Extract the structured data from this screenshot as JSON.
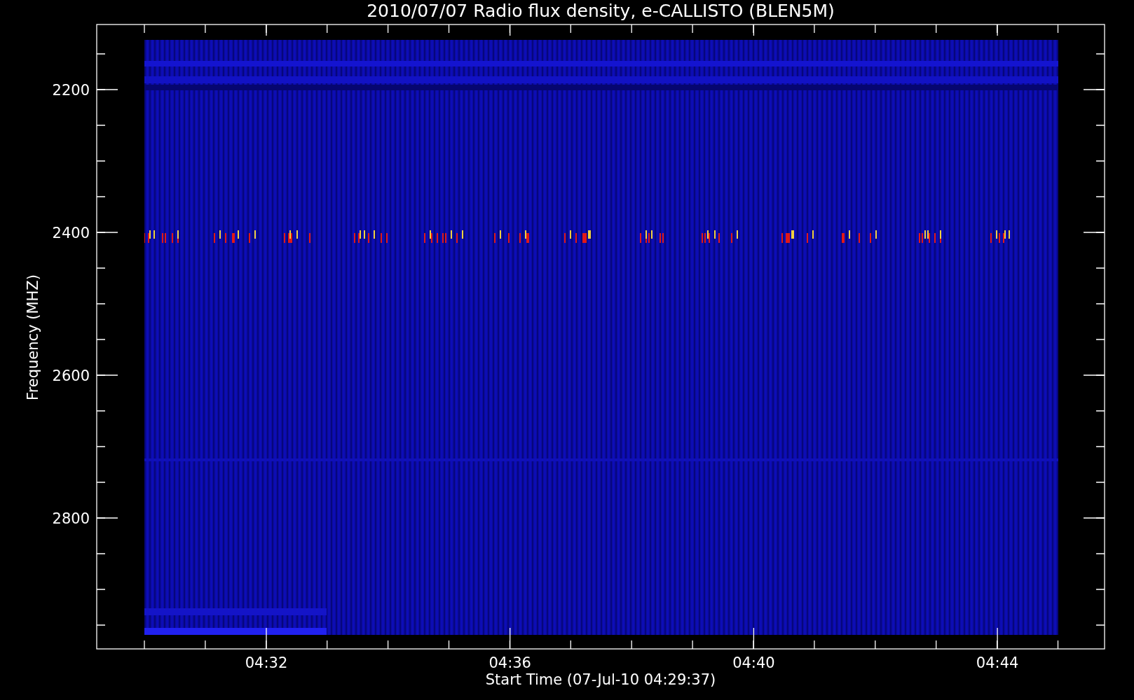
{
  "plot": {
    "title": "2010/07/07  Radio flux density, e-CALLISTO (BLEN5M)",
    "y_axis": {
      "label": "Frequency (MHZ)",
      "ticks": [
        "2200",
        "2400",
        "2600",
        "2800"
      ]
    },
    "x_axis": {
      "label": "Start Time (07-Jul-10 04:29:37)",
      "ticks": [
        "04:32",
        "04:36",
        "04:40",
        "04:44"
      ]
    }
  }
}
